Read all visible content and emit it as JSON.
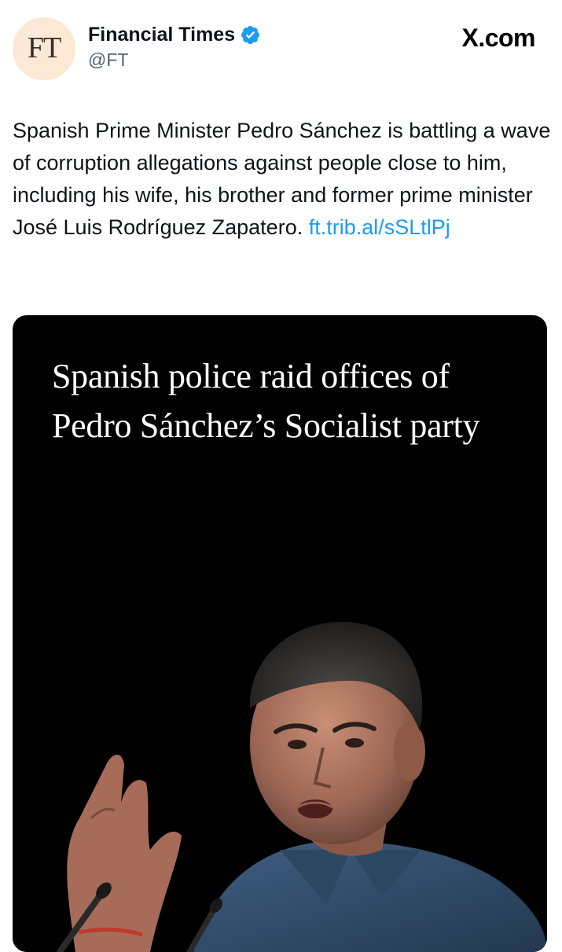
{
  "author": {
    "avatar_text": "FT",
    "display_name": "Financial Times",
    "handle": "@FT",
    "verified": true
  },
  "brand": "X.com",
  "tweet": {
    "text": "Spanish Prime Minister Pedro Sánchez is battling a wave of corruption allegations against people close to him, including his wife, his brother and former prime minister José Luis Rodríguez Zapatero. ",
    "link": "ft.trib.al/sSLtlPj"
  },
  "media": {
    "headline": "Spanish police raid offices of Pedro Sánchez’s Socialist party"
  },
  "colors": {
    "avatar_bg": "#fce8d4",
    "link": "#1d9bf0",
    "verified": "#1d9bf0",
    "card_bg": "#000000"
  }
}
